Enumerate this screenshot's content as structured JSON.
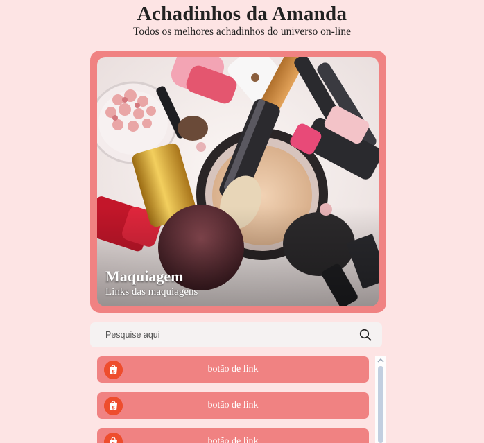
{
  "header": {
    "title": "Achadinhos da Amanda",
    "subtitle": "Todos os melhores achadinhos do universo on-line"
  },
  "hero": {
    "title": "Maquiagem",
    "subtitle": "Links das maquiagens",
    "image_alt": "makeup products photo"
  },
  "search": {
    "placeholder": "Pesquise aqui",
    "value": ""
  },
  "links": [
    {
      "label": "botão de link",
      "icon": "shopee-bag-icon"
    },
    {
      "label": "botão de link",
      "icon": "shopee-bag-icon"
    },
    {
      "label": "botão de link",
      "icon": "shopee-bag-icon"
    }
  ],
  "colors": {
    "background": "#fde4e4",
    "accent": "#f08282",
    "shopee": "#ee4d2d"
  }
}
